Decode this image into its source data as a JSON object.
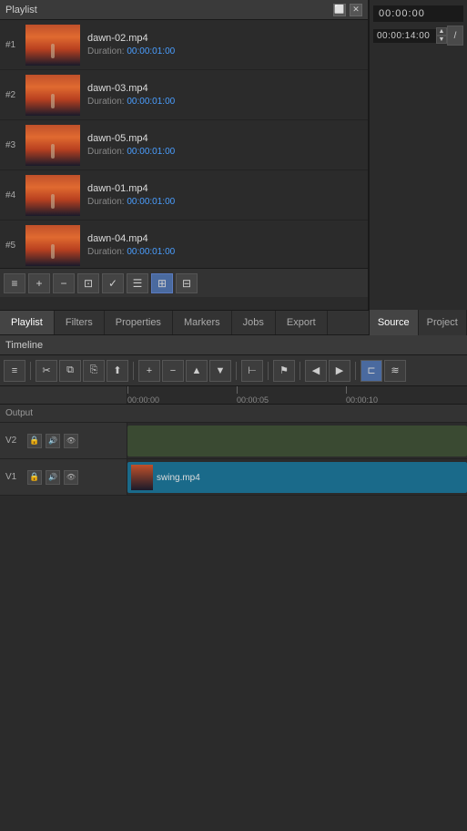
{
  "playlist": {
    "title": "Playlist",
    "items": [
      {
        "number": "#1",
        "name": "dawn-02.mp4",
        "duration_label": "Duration:",
        "duration_value": "00:00:01:00"
      },
      {
        "number": "#2",
        "name": "dawn-03.mp4",
        "duration_label": "Duration:",
        "duration_value": "00:00:01:00"
      },
      {
        "number": "#3",
        "name": "dawn-05.mp4",
        "duration_label": "Duration:",
        "duration_value": "00:00:01:00"
      },
      {
        "number": "#4",
        "name": "dawn-01.mp4",
        "duration_label": "Duration:",
        "duration_value": "00:00:01:00"
      },
      {
        "number": "#5",
        "name": "dawn-04.mp4",
        "duration_label": "Duration:",
        "duration_value": "00:00:01:00"
      }
    ]
  },
  "tabs": {
    "items": [
      "Playlist",
      "Filters",
      "Properties",
      "Markers",
      "Jobs",
      "Export"
    ]
  },
  "right_panel": {
    "timecode1": "00:00:00",
    "timecode2": "00:00:14:00",
    "tabs": [
      "Source",
      "Project"
    ]
  },
  "timeline": {
    "title": "Timeline",
    "output_label": "Output",
    "tracks": [
      {
        "label": "V2",
        "clip": null
      },
      {
        "label": "V1",
        "clip": "swing.mp4"
      }
    ],
    "ruler": {
      "marks": [
        "00:00:00",
        "00:00:05",
        "00:00:10"
      ]
    }
  },
  "icons": {
    "maximize": "⬜",
    "close": "✕",
    "menu": "≡",
    "add": "+",
    "remove": "−",
    "open": "⊡",
    "check": "✓",
    "list": "☰",
    "grid_list": "⊞",
    "grid": "⊟",
    "scissors": "✂",
    "copy": "⧉",
    "paste": "⎘",
    "lift": "⬆",
    "arrow_up": "▲",
    "arrow_down": "▼",
    "splice": "⊢",
    "flag": "⚑",
    "prev": "◀",
    "next": "▶",
    "magnet": "⊏",
    "ripple": "≋",
    "lock": "🔒",
    "mute": "🔊",
    "eye": "👁"
  }
}
